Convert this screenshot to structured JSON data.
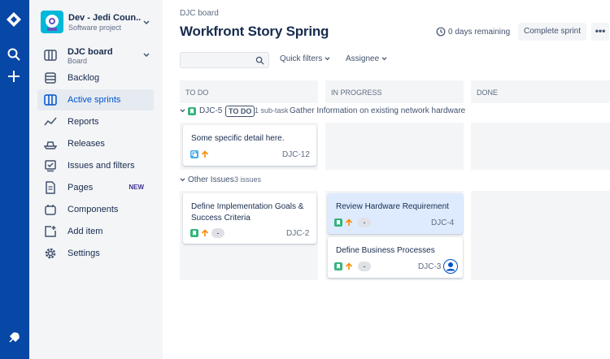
{
  "global_nav": {
    "icons": [
      "jira-logo-icon",
      "search-icon",
      "create-icon",
      "feedback-icon"
    ]
  },
  "sidebar": {
    "project": {
      "name": "Dev - Jedi Coun...",
      "type": "Software project"
    },
    "board": {
      "title": "DJC board",
      "subtitle": "Board"
    },
    "items": [
      {
        "label": "Backlog",
        "icon": "backlog-icon"
      },
      {
        "label": "Active sprints",
        "icon": "active-sprints-icon",
        "active": true
      },
      {
        "label": "Reports",
        "icon": "reports-icon"
      },
      {
        "label": "Releases",
        "icon": "releases-icon"
      },
      {
        "label": "Issues and filters",
        "icon": "issues-icon"
      },
      {
        "label": "Pages",
        "icon": "pages-icon",
        "badge": "NEW"
      },
      {
        "label": "Components",
        "icon": "components-icon"
      },
      {
        "label": "Add item",
        "icon": "add-item-icon"
      },
      {
        "label": "Settings",
        "icon": "settings-icon"
      }
    ]
  },
  "header": {
    "breadcrumb": "DJC board",
    "title": "Workfront Story Spring",
    "remaining": "0 days remaining",
    "complete_label": "Complete sprint",
    "more_label": "•••"
  },
  "filters": {
    "search_placeholder": "",
    "quick_filters": "Quick filters",
    "assignee": "Assignee"
  },
  "columns": [
    "TO DO",
    "IN PROGRESS",
    "DONE"
  ],
  "swimlanes": {
    "first": {
      "key": "DJC-5",
      "status": "TO DO",
      "subtasks": "1 sub-task",
      "summary": "Gather Information on existing network hardware"
    },
    "other": {
      "label": "Other Issues",
      "count": "3 issues"
    }
  },
  "cards": {
    "djc12": {
      "summary": "Some specific detail here.",
      "key": "DJC-12",
      "type": "subtask"
    },
    "djc2": {
      "summary": "Define Implementation Goals & Success Criteria",
      "key": "DJC-2",
      "estimate": "-"
    },
    "djc4": {
      "summary": "Review Hardware Requirement",
      "key": "DJC-4",
      "estimate": "-"
    },
    "djc3": {
      "summary": "Define Business Processes",
      "key": "DJC-3",
      "estimate": "-"
    }
  },
  "colors": {
    "nav_blue": "#0747a6",
    "story_green": "#36b37e",
    "priority_orange": "#ff8b00",
    "subtask_blue": "#4bade8"
  }
}
